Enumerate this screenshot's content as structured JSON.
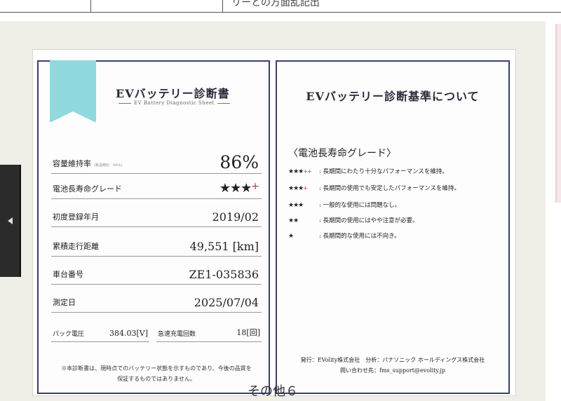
{
  "top_table": {
    "cell3_text": "リーとの方面乱記出"
  },
  "left_card": {
    "title": "EVバッテリー診断書",
    "subtitle": "EV Battery Diagnostic Sheet",
    "capacity_label": "容量維持率",
    "capacity_note": "(新品時比：89%)",
    "capacity_value": "86%",
    "grade_label": "電池長寿命グレード",
    "grade_stars": "★★★",
    "grade_plus": "+",
    "reg_label": "初度登録年月",
    "reg_value": "2019/02",
    "mileage_label": "累積走行距離",
    "mileage_value": "49,551 [km]",
    "vin_label": "車台番号",
    "vin_value": "ZE1-035836",
    "date_label": "測定日",
    "date_value": "2025/07/04",
    "pack_label": "パック電圧",
    "pack_value": "384.03[V]",
    "quick_label": "急速充電回数",
    "quick_value": "18[回]",
    "disclaimer_line1": "※本診断書は、現時点でのバッテリー状態を示すものであり、今後の品質を",
    "disclaimer_line2": "保証するものではありません。"
  },
  "right_card": {
    "title": "EVバッテリー診断基準について",
    "heading": "〈電池長寿命グレード〉",
    "grades": [
      {
        "stars": "★★★",
        "plus": "++",
        "text": ": 長期間にわたり十分なパフォーマンスを維持。"
      },
      {
        "stars": "★★★",
        "plus": "+",
        "text": ": 長期間の使用でも安定したパフォーマンスを維持。"
      },
      {
        "stars": "★★★",
        "plus": "",
        "text": ": 一般的な使用には問題なし。"
      },
      {
        "stars": "★★",
        "plus": "",
        "text": ": 長期間の使用にはやや注意が必要。"
      },
      {
        "stars": "★",
        "plus": "",
        "text": ": 長期間的な使用には不向き。"
      }
    ],
    "footer_line1": "発行：EVolity株式会社　分析：パナソニック ホールディングス株式会社",
    "footer_line2": "問い合わせ先：fms_support@evolity.jp"
  },
  "caption": "その他６",
  "colors": {
    "card_border": "#3a3f6b",
    "ribbon": "#8fd9df",
    "plus_red": "#d21f3c",
    "gallery_bg": "#efeee7"
  },
  "icons": {
    "prev": "left-arrow-icon"
  }
}
